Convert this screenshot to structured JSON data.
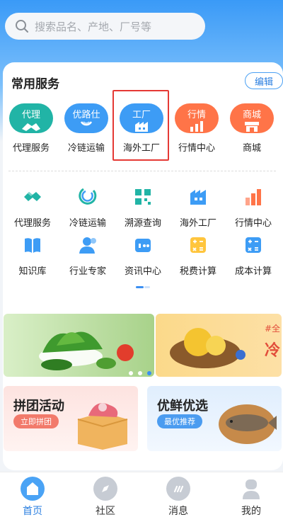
{
  "search": {
    "placeholder": "搜索品名、产地、厂号等"
  },
  "services": {
    "title": "常用服务",
    "edit_label": "编辑",
    "favorites": [
      {
        "pill_text": "代理",
        "label": "代理服务",
        "color": "#21b4a6"
      },
      {
        "pill_text": "优路仕",
        "label": "冷链运输",
        "color": "#3d9cf5"
      },
      {
        "pill_text": "工厂",
        "label": "海外工厂",
        "color": "#3d9cf5"
      },
      {
        "pill_text": "行情",
        "label": "行情中心",
        "color": "#ff7448"
      },
      {
        "pill_text": "商城",
        "label": "商城",
        "color": "#ff7448"
      }
    ],
    "grid": [
      {
        "label": "代理服务",
        "icon": "handshake-icon"
      },
      {
        "label": "冷链运输",
        "icon": "cold-chain-icon"
      },
      {
        "label": "溯源查询",
        "icon": "qr-trace-icon"
      },
      {
        "label": "海外工厂",
        "icon": "factory-icon"
      },
      {
        "label": "行情中心",
        "icon": "bar-chart-icon"
      },
      {
        "label": "知识库",
        "icon": "book-icon"
      },
      {
        "label": "行业专家",
        "icon": "expert-icon"
      },
      {
        "label": "资讯中心",
        "icon": "news-icon"
      },
      {
        "label": "税费计算",
        "icon": "tax-calculator-icon"
      },
      {
        "label": "成本计算",
        "icon": "cost-calculator-icon"
      }
    ]
  },
  "banner": {
    "right_tag": "#全",
    "right_big": "冷"
  },
  "promos": [
    {
      "title": "拼团活动",
      "chip": "立即拼团",
      "chip_color": "#f27a6b"
    },
    {
      "title": "优鲜优选",
      "chip": "最优推荐",
      "chip_color": "#4b9cf0"
    }
  ],
  "tabbar": [
    {
      "label": "首页",
      "icon": "home-icon",
      "active": true
    },
    {
      "label": "社区",
      "icon": "compass-icon",
      "active": false
    },
    {
      "label": "消息",
      "icon": "chat-icon",
      "active": false
    },
    {
      "label": "我的",
      "icon": "user-icon",
      "active": false
    }
  ],
  "colors": {
    "accent": "#3b8ff2",
    "highlight": "#e53935"
  }
}
